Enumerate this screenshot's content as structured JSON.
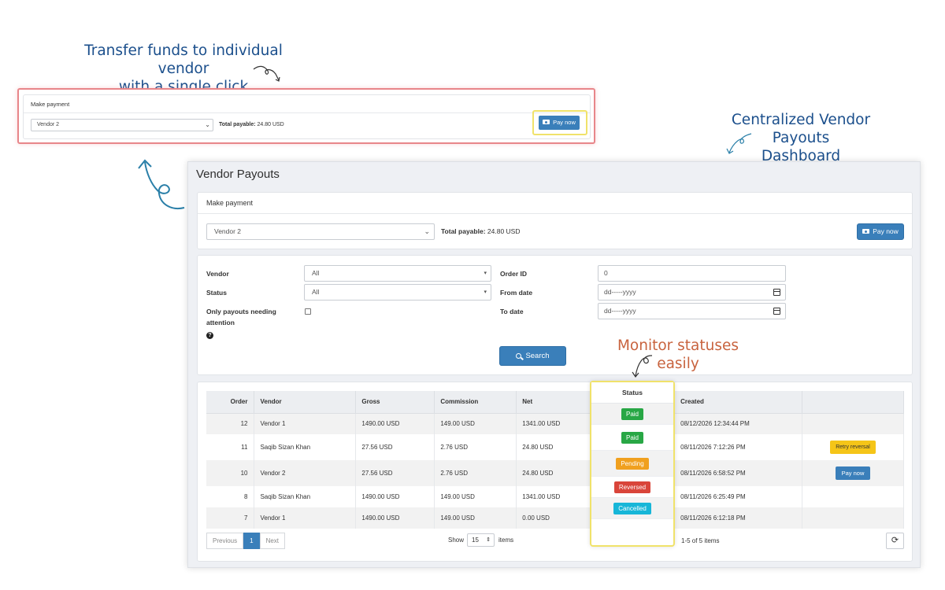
{
  "callouts": {
    "transfer_line1": "Transfer funds to individual vendor",
    "transfer_line2": "with a single click",
    "dashboard_line1": "Centralized Vendor Payouts",
    "dashboard_line2": "Dashboard",
    "monitor": "Monitor statuses easily"
  },
  "page_title": "Vendor Payouts",
  "make_payment": {
    "heading": "Make payment",
    "vendor_selected": "Vendor 2",
    "total_label": "Total payable:",
    "total_value": "24.80 USD",
    "pay_button": "Pay now"
  },
  "filters": {
    "vendor_label": "Vendor",
    "vendor_value": "All",
    "status_label": "Status",
    "status_value": "All",
    "attention_label_line1": "Only payouts needing",
    "attention_label_line2": "attention",
    "order_id_label": "Order ID",
    "order_id_value": "0",
    "from_date_label": "From date",
    "from_date_placeholder": "dd-----yyyy",
    "to_date_label": "To date",
    "to_date_placeholder": "dd-----yyyy",
    "search_button": "Search",
    "help_glyph": "?"
  },
  "table": {
    "columns": {
      "order": "Order",
      "vendor": "Vendor",
      "gross": "Gross",
      "commission": "Commission",
      "net": "Net",
      "status": "Status",
      "created": "Created"
    },
    "rows": [
      {
        "order": "12",
        "vendor": "Vendor 1",
        "gross": "1490.00 USD",
        "commission": "149.00 USD",
        "net": "1341.00 USD",
        "status": "Paid",
        "created": "08/12/2026 12:34:44 PM",
        "action": ""
      },
      {
        "order": "11",
        "vendor": "Saqib Sizan Khan",
        "gross": "27.56 USD",
        "commission": "2.76 USD",
        "net": "24.80 USD",
        "status": "Paid",
        "created": "08/11/2026 7:12:26 PM",
        "action": "Retry reversal"
      },
      {
        "order": "10",
        "vendor": "Vendor 2",
        "gross": "27.56 USD",
        "commission": "2.76 USD",
        "net": "24.80 USD",
        "status": "Pending",
        "created": "08/11/2026 6:58:52 PM",
        "action": "Pay now"
      },
      {
        "order": "8",
        "vendor": "Saqib Sizan Khan",
        "gross": "1490.00 USD",
        "commission": "149.00 USD",
        "net": "1341.00 USD",
        "status": "Reversed",
        "created": "08/11/2026 6:25:49 PM",
        "action": ""
      },
      {
        "order": "7",
        "vendor": "Vendor 1",
        "gross": "1490.00 USD",
        "commission": "149.00 USD",
        "net": "0.00 USD",
        "status": "Cancelled",
        "created": "08/11/2026 6:12:18 PM",
        "action": ""
      }
    ]
  },
  "pagination": {
    "previous": "Previous",
    "current_page": "1",
    "next": "Next",
    "show_label": "Show",
    "page_size": "15",
    "items_label": "items",
    "range": "1-5 of 5 items"
  },
  "icons": {
    "pay": "camera-icon",
    "search": "search-icon",
    "refresh": "refresh-icon",
    "calendar": "calendar-icon",
    "help": "help-icon",
    "chevron": "chevron-down-icon"
  },
  "colors": {
    "primary": "#3a7fba",
    "paid": "#28a745",
    "pending": "#f0a01f",
    "reversed": "#d9453a",
    "cancelled": "#17b6d8",
    "retry": "#f5c518",
    "callout_blue": "#1b4f8c",
    "callout_orange": "#c8633e",
    "snippet_border": "#e8868a",
    "highlight_border": "#f0e26a"
  }
}
